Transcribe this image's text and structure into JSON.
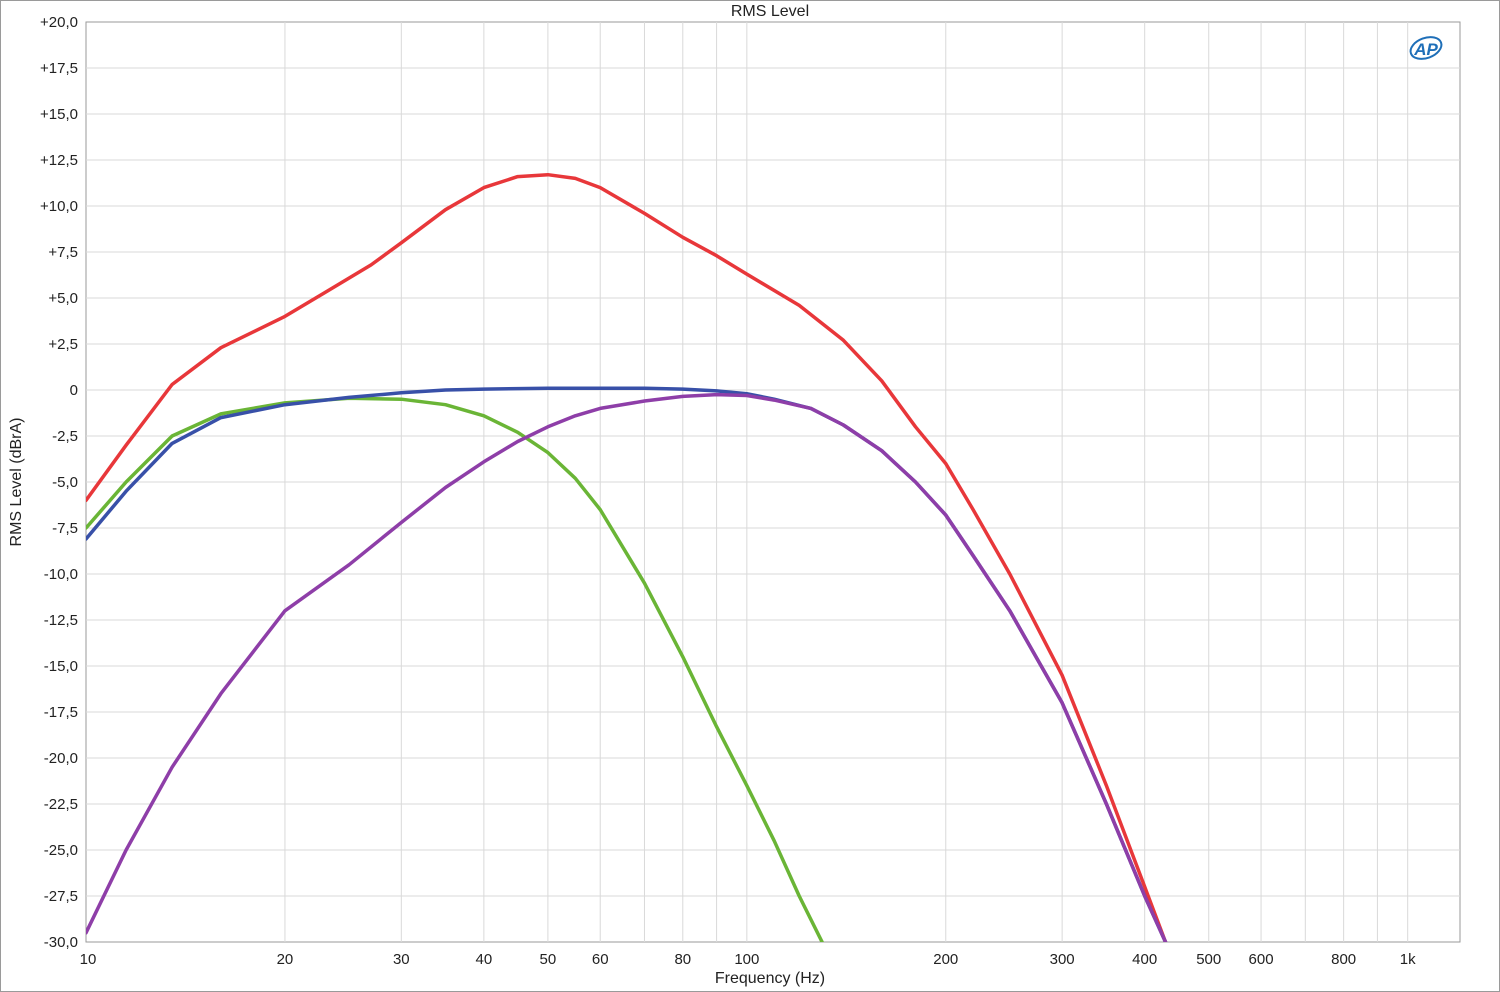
{
  "chart_data": {
    "type": "line",
    "title": "RMS Level",
    "xlabel": "Frequency (Hz)",
    "ylabel": "RMS Level (dBrA)",
    "x_scale": "log",
    "xlim": [
      10,
      1200
    ],
    "ylim": [
      -30,
      20
    ],
    "grid": true,
    "logo": "AP",
    "x_ticks": [
      10,
      20,
      30,
      40,
      50,
      60,
      80,
      100,
      200,
      300,
      400,
      500,
      600,
      800,
      1000
    ],
    "x_tick_labels": [
      "10",
      "20",
      "30",
      "40",
      "50",
      "60",
      "80",
      "100",
      "200",
      "300",
      "400",
      "500",
      "600",
      "800",
      "1k"
    ],
    "x_minor_grid": [
      70,
      90,
      700,
      900
    ],
    "y_ticks": [
      20,
      17.5,
      15,
      12.5,
      10,
      7.5,
      5,
      2.5,
      0,
      -2.5,
      -5,
      -7.5,
      -10,
      -12.5,
      -15,
      -17.5,
      -20,
      -22.5,
      -25,
      -27.5,
      -30
    ],
    "y_tick_labels": [
      "+20,0",
      "+17,5",
      "+15,0",
      "+12,5",
      "+10,0",
      "+7,5",
      "+5,0",
      "+2,5",
      "0",
      "-2,5",
      "-5,0",
      "-7,5",
      "-10,0",
      "-12,5",
      "-15,0",
      "-17,5",
      "-20,0",
      "-22,5",
      "-25,0",
      "-27,5",
      "-30,0"
    ],
    "series": [
      {
        "color": "#e8373a",
        "x": [
          10,
          11.5,
          13.5,
          16,
          20,
          23,
          27,
          30,
          35,
          40,
          45,
          50,
          55,
          60,
          70,
          80,
          90,
          100,
          120,
          140,
          160,
          180,
          200,
          220,
          250,
          300,
          350,
          400,
          430
        ],
        "y": [
          -6,
          -3,
          0.3,
          2.3,
          4,
          5.3,
          6.8,
          8,
          9.8,
          11,
          11.6,
          11.7,
          11.5,
          11,
          9.6,
          8.3,
          7.3,
          6.3,
          4.6,
          2.7,
          0.5,
          -2,
          -4,
          -6.5,
          -10,
          -15.5,
          -21.5,
          -27,
          -30
        ]
      },
      {
        "color": "#3850a8",
        "x": [
          10,
          11.5,
          13.5,
          16,
          20,
          25,
          30,
          35,
          40,
          50,
          60,
          70,
          80,
          90,
          100,
          110,
          125,
          140,
          160,
          180,
          200,
          220,
          250,
          300,
          350,
          400,
          430
        ],
        "y": [
          -8.1,
          -5.5,
          -2.9,
          -1.5,
          -0.8,
          -0.4,
          -0.15,
          0,
          0.05,
          0.1,
          0.1,
          0.1,
          0.05,
          -0.05,
          -0.2,
          -0.5,
          -1,
          -1.9,
          -3.3,
          -5,
          -6.8,
          -9,
          -12,
          -17,
          -22.5,
          -27.5,
          -30
        ]
      },
      {
        "color": "#6ab536",
        "x": [
          10,
          11.5,
          13.5,
          16,
          20,
          25,
          30,
          35,
          40,
          45,
          50,
          55,
          60,
          70,
          80,
          90,
          100,
          110,
          120,
          130
        ],
        "y": [
          -7.5,
          -5,
          -2.5,
          -1.3,
          -0.7,
          -0.45,
          -0.5,
          -0.8,
          -1.4,
          -2.3,
          -3.4,
          -4.8,
          -6.5,
          -10.5,
          -14.5,
          -18.3,
          -21.5,
          -24.5,
          -27.5,
          -30
        ]
      },
      {
        "color": "#8e3ea8",
        "x": [
          10,
          11.5,
          13.5,
          16,
          20,
          25,
          30,
          35,
          40,
          45,
          50,
          55,
          60,
          70,
          80,
          90,
          100,
          110,
          125,
          140,
          160,
          180,
          200,
          220,
          250,
          300,
          350,
          400,
          430
        ],
        "y": [
          -29.5,
          -25,
          -20.5,
          -16.5,
          -12,
          -9.5,
          -7.2,
          -5.3,
          -3.9,
          -2.8,
          -2,
          -1.4,
          -1,
          -0.6,
          -0.35,
          -0.25,
          -0.3,
          -0.55,
          -1,
          -1.9,
          -3.3,
          -5,
          -6.8,
          -9,
          -12,
          -17,
          -22.5,
          -27.5,
          -30
        ]
      }
    ]
  }
}
